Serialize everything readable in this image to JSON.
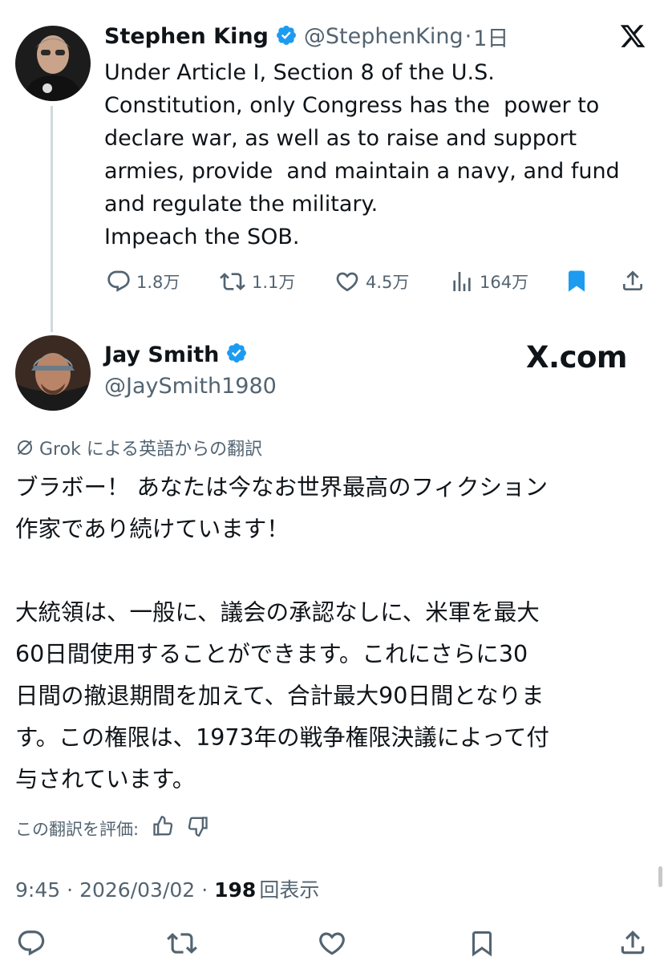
{
  "parent_tweet": {
    "author_name": "Stephen King",
    "handle": "@StephenKing",
    "separator": "·",
    "time": "1日",
    "text_lines": [
      "Under Article I, Section 8 of the U.S.",
      "Constitution, only Congress has the  power to",
      "declare war, as well as to raise and support",
      "armies, provide  and maintain a navy, and fund",
      "and regulate the military.",
      "Impeach the SOB."
    ],
    "actions": {
      "replies": "1.8万",
      "reposts": "1.1万",
      "likes": "4.5万",
      "views": "164万"
    }
  },
  "reply_tweet": {
    "author_name": "Jay Smith",
    "handle": "@JaySmith1980",
    "watermark": "X.com",
    "translation_label": "Grok による英語からの翻訳",
    "text_lines": [
      "ブラボー！ あなたは今なお世界最高のフィクション",
      "作家であり続けています！",
      "",
      "大統領は、一般に、議会の承認なしに、米軍を最大",
      "60日間使用することができます。これにさらに30",
      "日間の撤退期間を加えて、合計最大90日間となりま",
      "す。この権限は、1973年の戦争権限決議によって付",
      "与されています。"
    ],
    "rate_label": "この翻訳を評価:",
    "time": "9:45",
    "date": "2026/03/02",
    "dot": "·",
    "view_count": "198",
    "view_label": "回表示"
  },
  "icons": {
    "close": "x-logo-icon",
    "verified_color": "#1d9bf0",
    "bookmark_color": "#1d9bf0"
  }
}
